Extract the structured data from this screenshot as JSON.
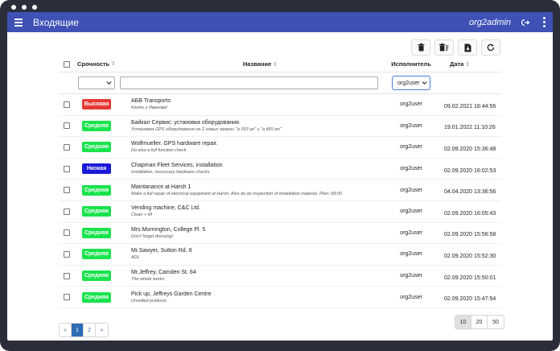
{
  "app": {
    "title": "Входящие",
    "user": "org2admin"
  },
  "icons": {
    "menu": "menu-icon",
    "logout": "logout-icon",
    "more": "more-vertical-icon"
  },
  "colors": {
    "topbar": "#3f51b5",
    "high": "#e53935",
    "medium": "#19e34c",
    "low": "#1a1ad6"
  },
  "table": {
    "headers": {
      "priority": "Срочность",
      "name": "Название",
      "executor": "Исполнитель",
      "date": "Дата"
    },
    "filters": {
      "executor_selected": "org2user"
    },
    "rows": [
      {
        "priority": "Высокая",
        "level": "high",
        "title": "АБВ Transports",
        "subtitle": "Ключи у Иванова!",
        "executor": "org2user",
        "date": "09.02.2021 16:44:56"
      },
      {
        "priority": "Средняя",
        "level": "medium",
        "title": "Байкал Сервис: установка оборудования.",
        "subtitle": "Установка GPS оборудования на 2 новых газели: \"а 053 уе\" и \"а 465 мх\"",
        "executor": "org2user",
        "date": "19.01.2022 11:10:26"
      },
      {
        "priority": "Средняя",
        "level": "medium",
        "title": "Wolfmueller. GPS hardware repair.",
        "subtitle": "Do also a full function check",
        "executor": "org2user",
        "date": "02.09.2020 15:36:48"
      },
      {
        "priority": "Низкая",
        "level": "low",
        "title": "Chapman Fleet Services, installation",
        "subtitle": "Installation, necessary hardware checks",
        "executor": "org2user",
        "date": "02.09.2020 16:02:53"
      },
      {
        "priority": "Средняя",
        "level": "medium",
        "title": "Maintanance at Harsh 1",
        "subtitle": "Make a full repair of electrical equipment at Harsh. Also do an inspection of installation material. Plan: 08:00",
        "executor": "org2user",
        "date": "04.04.2020 13:36:56"
      },
      {
        "priority": "Средняя",
        "level": "medium",
        "title": "Vending machine, C&C Ltd.",
        "subtitle": "Clean + fill",
        "executor": "org2user",
        "date": "02.09.2020 16:05:43"
      },
      {
        "priority": "Средняя",
        "level": "medium",
        "title": "Mrs.Mornington, College Pl. 5",
        "subtitle": "Don't forget dressing!",
        "executor": "org2user",
        "date": "02.09.2020 15:56:58"
      },
      {
        "priority": "Средняя",
        "level": "medium",
        "title": "Mr.Sawyer, Sutton Rd. 8",
        "subtitle": "ADL",
        "executor": "org2user",
        "date": "02.09.2020 15:52:30"
      },
      {
        "priority": "Средняя",
        "level": "medium",
        "title": "Mr.Jeffrey, Camden St. 64",
        "subtitle": "The whole works",
        "executor": "org2user",
        "date": "02.09.2020 15:50:01"
      },
      {
        "priority": "Средняя",
        "level": "medium",
        "title": "Pick up, Jeffreys Garden Centre",
        "subtitle": "Unselled products",
        "executor": "org2user",
        "date": "02.09.2020 15:47:54"
      }
    ]
  },
  "pagination": {
    "prev": "«",
    "pages": [
      "1",
      "2"
    ],
    "next": "»",
    "current": "1"
  },
  "page_sizes": {
    "options": [
      "10",
      "20",
      "50"
    ],
    "selected": "10"
  }
}
